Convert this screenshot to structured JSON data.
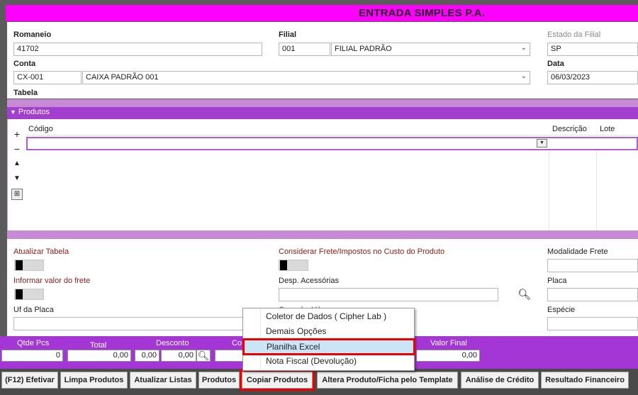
{
  "window": {
    "title": "ENTRADA SIMPLES P.A."
  },
  "header": {
    "romaneio_label": "Romaneio",
    "romaneio_value": "41702",
    "filial_label": "Filial",
    "filial_code": "001",
    "filial_name": "FILIAL PADRÃO",
    "estado_label": "Estado da Filial",
    "estado_value": "SP",
    "conta_label": "Conta",
    "conta_code": "CX-001",
    "conta_name": "CAIXA PADRÃO 001",
    "data_label": "Data",
    "data_value": "06/03/2023",
    "tabela_label": "Tabela"
  },
  "produtos": {
    "section_label": "Produtos",
    "columns": [
      "Código",
      "Descrição",
      "Lote"
    ],
    "tools": [
      "+",
      "−",
      "▲",
      "▼"
    ]
  },
  "lower": {
    "atualizar_tabela_label": "Atualizar Tabela",
    "considerar_frete_label": "Considerar Frete/Impostos no Custo do Produto",
    "modalidade_frete_label": "Modalidade Frete",
    "informar_frete_label": "Informar valor do frete",
    "desp_acessorias_label": "Desp. Acessórias",
    "placa_label": "Placa",
    "uf_placa_label": "Uf da Placa",
    "partial_label": "Consul... V.l...",
    "especie_label": "Espécie"
  },
  "totals": {
    "qtde_pcs_label": "Qtde Pcs",
    "qtde_pcs_value": "0",
    "total_label": "Total",
    "total_value": "0,00",
    "desconto_label": "Desconto",
    "desconto_pct": "0,00",
    "desconto_value": "0,00",
    "partial_label": "Co",
    "valor_final_label": "Valor Final",
    "valor_final_value": "0,00"
  },
  "menu": {
    "items": [
      "Coletor de Dados ( Cipher Lab )",
      "Demais Opções",
      "Planilha Excel",
      "Nota Fiscal (Devolução)"
    ],
    "selected_index": 2
  },
  "buttons": {
    "efetivar": "(F12) Efetivar",
    "limpa_produtos": "Limpa Produtos",
    "atualizar_listas": "Atualizar Listas",
    "produtos": "Produtos",
    "copiar_produtos": "Copiar Produtos",
    "altera_produto": "Altera Produto/Ficha pelo Template",
    "analise_credito": "Análise de Crédito",
    "resultado_financeiro": "Resultado Financeiro"
  },
  "colors": {
    "title_bar": "#ff00ff",
    "section_bar": "#a23fcf",
    "totals_bar": "#a436d6",
    "highlight": "#ee0000"
  }
}
